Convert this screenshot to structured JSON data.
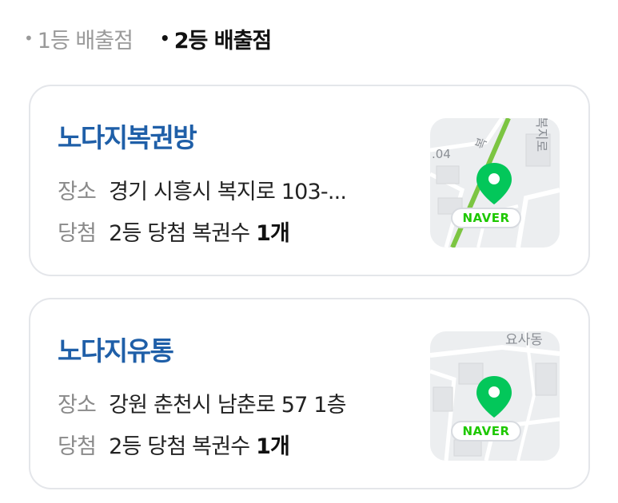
{
  "tabs": [
    {
      "label": "1등 배출점",
      "active": false
    },
    {
      "label": "2등 배출점",
      "active": true
    }
  ],
  "stores": [
    {
      "name": "노다지복권방",
      "address_label": "장소",
      "address": "경기 시흥시 복지로 103-...",
      "win_label": "당첨",
      "win_prefix": "2등 당첨 복권수 ",
      "win_count": "1개",
      "map": {
        "badge": "NAVER",
        "map_labels": [
          ".04",
          "복",
          "복지로"
        ]
      }
    },
    {
      "name": "노다지유통",
      "address_label": "장소",
      "address": "강원 춘천시 남춘로 57 1층",
      "win_label": "당첨",
      "win_prefix": "2등 당첨 복권수 ",
      "win_count": "1개",
      "map": {
        "badge": "NAVER",
        "map_labels": [
          "요사동"
        ]
      }
    }
  ],
  "colors": {
    "store_name": "#1f5fa8",
    "naver_green": "#1ec800",
    "pin_green": "#03c75a"
  }
}
